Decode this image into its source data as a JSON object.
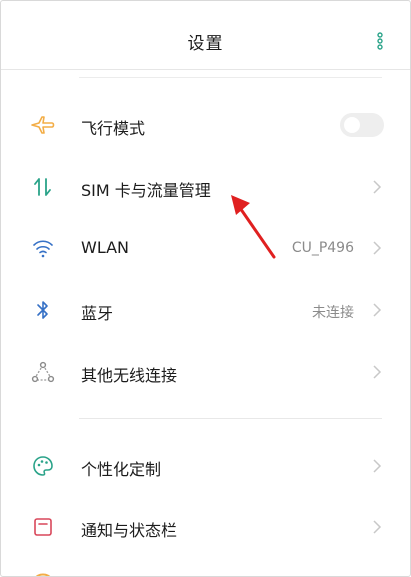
{
  "header": {
    "title": "设置",
    "more_icon": "more-vertical-icon"
  },
  "colors": {
    "accent": "#f3ad46",
    "icon_teal": "#2aa389",
    "icon_blue": "#3671c6",
    "icon_red": "#d9475a",
    "annotation_red": "#e02020"
  },
  "sections": {
    "network": [
      {
        "label": "飞行模式",
        "icon": "airplane-icon",
        "control": "toggle",
        "toggle_on": false
      },
      {
        "label": "SIM 卡与流量管理",
        "icon": "sim-data-icon"
      },
      {
        "label": "WLAN",
        "icon": "wifi-icon",
        "value": "CU_P496"
      },
      {
        "label": "蓝牙",
        "icon": "bluetooth-icon",
        "value": "未连接"
      },
      {
        "label": "其他无线连接",
        "icon": "wireless-connection-icon"
      }
    ],
    "personal": [
      {
        "label": "个性化定制",
        "icon": "palette-icon"
      },
      {
        "label": "通知与状态栏",
        "icon": "notification-icon"
      }
    ]
  }
}
